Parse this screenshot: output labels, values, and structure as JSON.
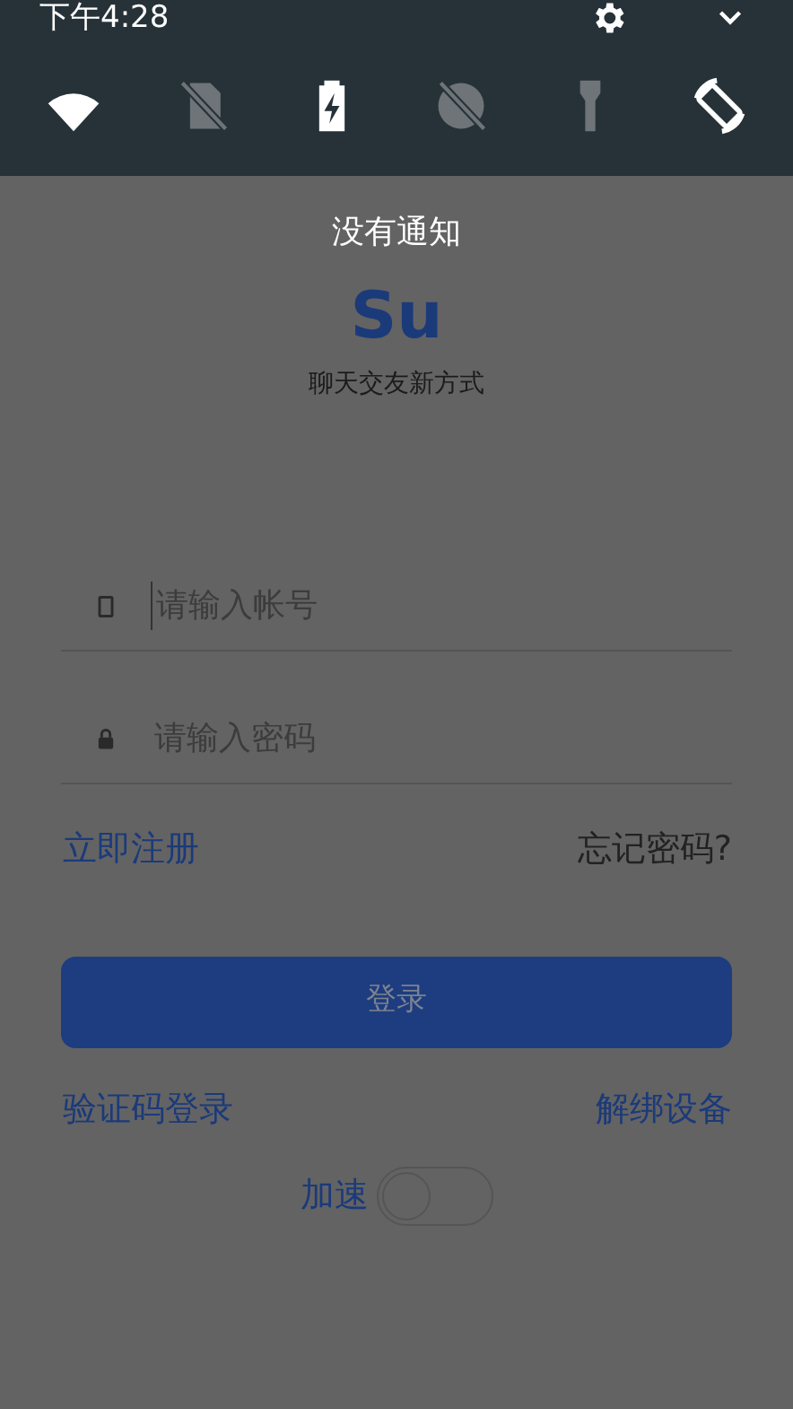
{
  "status_bar": {
    "time": "下午4:28"
  },
  "quick_settings": [
    {
      "kind": "wifi",
      "on": true
    },
    {
      "kind": "sim",
      "on": false
    },
    {
      "kind": "battery",
      "on": true
    },
    {
      "kind": "data-saver",
      "on": false
    },
    {
      "kind": "flashlight",
      "on": false
    },
    {
      "kind": "rotate",
      "on": true
    }
  ],
  "notice": "没有通知",
  "app": {
    "logo": "Su",
    "tagline": "聊天交友新方式",
    "fields": [
      {
        "kind": "phone",
        "placeholder": "请输入帐号",
        "focused": true
      },
      {
        "kind": "lock",
        "placeholder": "请输入密码",
        "focused": false
      }
    ],
    "register_link": "立即注册",
    "forgot_link": "忘记密码?",
    "login_button": "登录",
    "sms_login_link": "验证码登录",
    "unbind_link": "解绑设备",
    "speedup": {
      "label": "加速",
      "on": false
    }
  }
}
